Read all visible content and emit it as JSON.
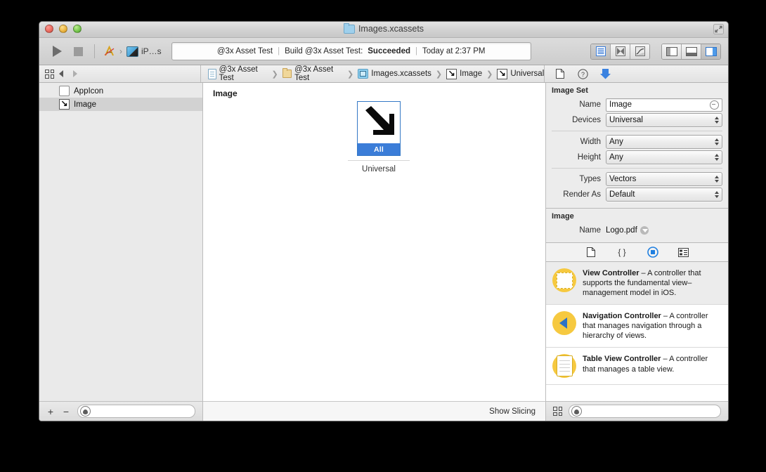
{
  "window": {
    "title": "Images.xcassets",
    "title_icon": "folder-icon",
    "controls": {
      "close": "close-button",
      "minimize": "minimize-button",
      "zoom": "zoom-button"
    },
    "expand_icon": "expand-icon"
  },
  "toolbar": {
    "run_icon": "run-play-icon",
    "stop_icon": "stop-square-icon",
    "scheme_app": "xcode-app-icon",
    "scheme_separator": "›",
    "destination_icon": "device-icon",
    "destination_label": "iP…s",
    "status": {
      "project": "@3x Asset Test",
      "separator": "|",
      "activity": "Build @3x Asset Test:",
      "result": "Succeeded",
      "time": "Today at 2:37 PM"
    },
    "view_buttons": [
      {
        "name": "standard-editor-button",
        "icon": "lines-icon",
        "selected": true
      },
      {
        "name": "assistant-editor-button",
        "icon": "bowtie-icon",
        "selected": false
      },
      {
        "name": "version-editor-button",
        "icon": "version-icon",
        "selected": false
      }
    ],
    "pane_buttons": [
      {
        "name": "toggle-navigator-button",
        "icon": "left-panel-icon",
        "selected": false
      },
      {
        "name": "toggle-debug-area-button",
        "icon": "bottom-panel-icon",
        "selected": false
      },
      {
        "name": "toggle-utilities-button",
        "icon": "right-panel-icon",
        "selected": true
      }
    ]
  },
  "jumpbar": {
    "grid_icon": "related-items-icon",
    "back_icon": "back-arrow-icon",
    "forward_icon": "forward-arrow-icon",
    "breadcrumbs": [
      {
        "label": "@3x Asset Test",
        "icon": "project-icon"
      },
      {
        "label": "@3x Asset Test",
        "icon": "folder-icon"
      },
      {
        "label": "Images.xcassets",
        "icon": "xcassets-icon"
      },
      {
        "label": "Image",
        "icon": "imageset-icon"
      },
      {
        "label": "Universal",
        "icon": "imageset-icon"
      }
    ],
    "inspector_tabs": [
      {
        "name": "file-inspector-tab",
        "icon": "document-icon"
      },
      {
        "name": "quick-help-inspector-tab",
        "icon": "question-circle-icon"
      },
      {
        "name": "attributes-inspector-tab",
        "icon": "attributes-arrow-icon",
        "selected": true
      }
    ]
  },
  "navigator": {
    "items": [
      {
        "label": "AppIcon",
        "icon": "appicon-set-icon",
        "selected": false
      },
      {
        "label": "Image",
        "icon": "imageset-icon",
        "selected": true
      }
    ],
    "add_label": "+",
    "remove_label": "−",
    "filter_placeholder": "",
    "filter_value": "",
    "filter_icon": "filter-lens-icon"
  },
  "editor": {
    "title": "Image",
    "slot": {
      "artwork_icon": "diagonal-arrow-artwork",
      "scale_label": "All",
      "caption": "Universal"
    },
    "show_slicing_label": "Show Slicing"
  },
  "inspector": {
    "image_set": {
      "section_title": "Image Set",
      "fields": [
        {
          "label": "Name",
          "type": "text",
          "value": "Image",
          "name": "name-field"
        },
        {
          "label": "Devices",
          "type": "popup",
          "value": "Universal",
          "name": "devices-popup"
        },
        {
          "label": "Width",
          "type": "popup",
          "value": "Any",
          "name": "width-popup"
        },
        {
          "label": "Height",
          "type": "popup",
          "value": "Any",
          "name": "height-popup"
        },
        {
          "label": "Types",
          "type": "popup",
          "value": "Vectors",
          "name": "types-popup"
        },
        {
          "label": "Render As",
          "type": "popup",
          "value": "Default",
          "name": "render-as-popup"
        }
      ]
    },
    "image": {
      "section_title": "Image",
      "name_label": "Name",
      "name_value": "Logo.pdf",
      "reveal_icon": "reveal-in-finder-icon"
    }
  },
  "library": {
    "tabs": [
      {
        "name": "file-template-library-tab",
        "icon": "document-icon",
        "selected": false
      },
      {
        "name": "code-snippet-library-tab",
        "icon": "braces-icon",
        "selected": false
      },
      {
        "name": "object-library-tab",
        "icon": "circle-dot-icon",
        "selected": true
      },
      {
        "name": "media-library-tab",
        "icon": "media-icon",
        "selected": false
      }
    ],
    "items": [
      {
        "name": "library-item-view-controller",
        "icon": "view-controller-icon",
        "title": "View Controller",
        "dash": " – ",
        "description": "A controller that supports the fundamental view–management model in iOS.",
        "selected": true
      },
      {
        "name": "library-item-navigation-controller",
        "icon": "navigation-controller-icon",
        "title": "Navigation Controller",
        "dash": " – ",
        "description": "A controller that manages navigation through a hierarchy of views.",
        "selected": false
      },
      {
        "name": "library-item-table-view-controller",
        "icon": "table-view-controller-icon",
        "title": "Table View Controller",
        "dash": " – ",
        "description": "A controller that manages a table view.",
        "selected": false
      }
    ],
    "grid_icon": "library-grid-icon",
    "filter_icon": "filter-lens-icon",
    "filter_value": ""
  },
  "colors": {
    "accent_blue": "#3b7dd8",
    "selection_blue": "#3478c6",
    "library_yellow": "#f6c940",
    "chrome_gray": "#ececec"
  }
}
